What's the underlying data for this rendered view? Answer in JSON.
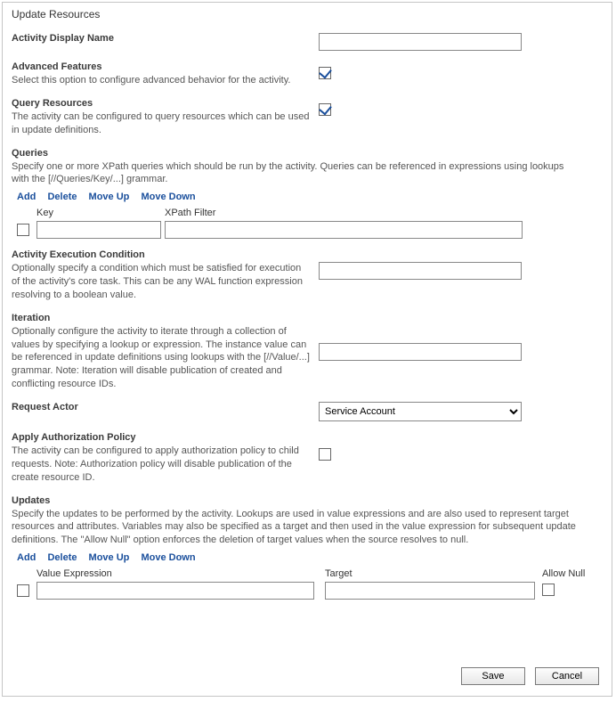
{
  "panelTitle": "Update Resources",
  "activityDisplayName": {
    "label": "Activity Display Name",
    "value": ""
  },
  "advancedFeatures": {
    "label": "Advanced Features",
    "desc": "Select this option to configure advanced behavior for the activity.",
    "checked": true
  },
  "queryResources": {
    "label": "Query Resources",
    "desc": "The activity can be configured to query resources which can be used in update definitions.",
    "checked": true
  },
  "queries": {
    "label": "Queries",
    "desc": "Specify one or more XPath queries which should be run by the activity. Queries can be referenced in expressions using lookups with the [//Queries/Key/...] grammar.",
    "actions": {
      "add": "Add",
      "delete": "Delete",
      "moveUp": "Move Up",
      "moveDown": "Move Down"
    },
    "headers": {
      "key": "Key",
      "xpath": "XPath Filter"
    },
    "rows": [
      {
        "selected": false,
        "key": "",
        "xpath": ""
      }
    ]
  },
  "activityExecCondition": {
    "label": "Activity Execution Condition",
    "desc": "Optionally specify a condition which must be satisfied for execution of the activity's core task. This can be any WAL function expression resolving to a boolean value.",
    "value": ""
  },
  "iteration": {
    "label": "Iteration",
    "desc": "Optionally configure the activity to iterate through a collection of values by specifying a lookup or expression. The instance value can be referenced in update definitions using lookups with the [//Value/...] grammar. Note: Iteration will disable publication of created and conflicting resource IDs.",
    "value": ""
  },
  "requestActor": {
    "label": "Request Actor",
    "options": [
      "Service Account"
    ],
    "selected": "Service Account"
  },
  "applyAuthPolicy": {
    "label": "Apply Authorization Policy",
    "desc": "The activity can be configured to apply authorization policy to child requests. Note: Authorization policy will disable publication of the create resource ID.",
    "checked": false
  },
  "updates": {
    "label": "Updates",
    "desc": "Specify the updates to be performed by the activity. Lookups are used in value expressions and are also used to represent target resources and attributes. Variables may also be specified as a target and then used in the value expression for subsequent update definitions. The \"Allow Null\" option enforces the deletion of target values when the source resolves to null.",
    "actions": {
      "add": "Add",
      "delete": "Delete",
      "moveUp": "Move Up",
      "moveDown": "Move Down"
    },
    "headers": {
      "valueExpr": "Value Expression",
      "target": "Target",
      "allowNull": "Allow Null"
    },
    "rows": [
      {
        "selected": false,
        "valueExpr": "",
        "target": "",
        "allowNull": false
      }
    ]
  },
  "buttons": {
    "save": "Save",
    "cancel": "Cancel"
  }
}
